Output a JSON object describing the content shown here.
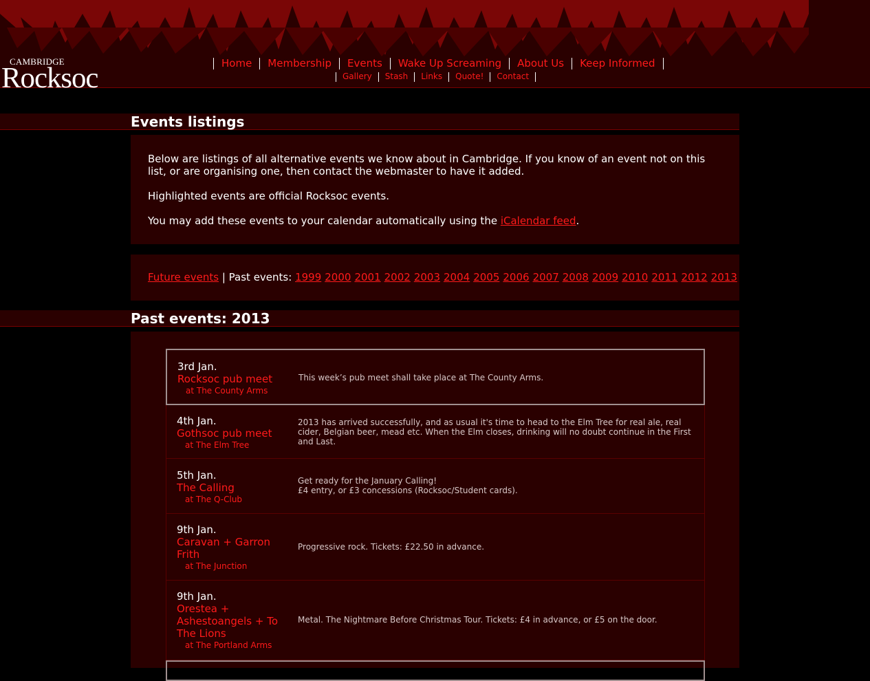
{
  "logo": {
    "small": "CAMBRIDGE",
    "big": "Rocksoc"
  },
  "nav": {
    "main": [
      "Home",
      "Membership",
      "Events",
      "Wake Up Screaming",
      "About Us",
      "Keep Informed"
    ],
    "sub": [
      "Gallery",
      "Stash",
      "Links",
      "Quote!",
      "Contact"
    ]
  },
  "listings": {
    "title": "Events listings",
    "intro": "Below are listings of all alternative events we know about in Cambridge. If you know of an event not on this list, or are organising one, then contact the webmaster to have it added.",
    "highlight_note": "Highlighted events are official Rocksoc events.",
    "ical_prefix": "You may add these events to your calendar automatically using the ",
    "ical_link": "iCalendar feed",
    "ical_suffix": "."
  },
  "archive": {
    "future_link": "Future events",
    "past_label": " | Past events: ",
    "years": [
      "1999",
      "2000",
      "2001",
      "2002",
      "2003",
      "2004",
      "2005",
      "2006",
      "2007",
      "2008",
      "2009",
      "2010",
      "2011",
      "2012",
      "2013"
    ]
  },
  "past": {
    "title": "Past events: 2013",
    "events": [
      {
        "date": "3rd Jan.",
        "name": "Rocksoc pub meet",
        "venue": "at The County Arms",
        "desc": "This week’s pub meet shall take place at The County Arms.",
        "highlight": true
      },
      {
        "date": "4th Jan.",
        "name": "Gothsoc pub meet",
        "venue": "at The Elm Tree",
        "desc": "2013 has arrived successfully, and as usual it's time to head to the Elm Tree for real ale, real cider, Belgian beer, mead etc. When the Elm closes, drinking will no doubt continue in the First and Last.",
        "highlight": false
      },
      {
        "date": "5th Jan.",
        "name": "The Calling",
        "venue": "at The Q-Club",
        "desc": "Get ready for the January Calling!\n£4 entry, or £3 concessions (Rocksoc/Student cards).",
        "highlight": false
      },
      {
        "date": "9th Jan.",
        "name": "Caravan + Garron Frith",
        "venue": "at The Junction",
        "desc": "Progressive rock. Tickets: £22.50 in advance.",
        "highlight": false
      },
      {
        "date": "9th Jan.",
        "name": "Orestea + Ashestoangels + To The Lions",
        "venue": "at The Portland Arms",
        "desc": "Metal. The Nightmare Before Christmas Tour. Tickets: £4 in advance, or £5 on the door.",
        "highlight": false
      }
    ]
  },
  "colors": {
    "accent": "#ff1a1a",
    "panel": "#2a0000",
    "background": "#000000"
  }
}
